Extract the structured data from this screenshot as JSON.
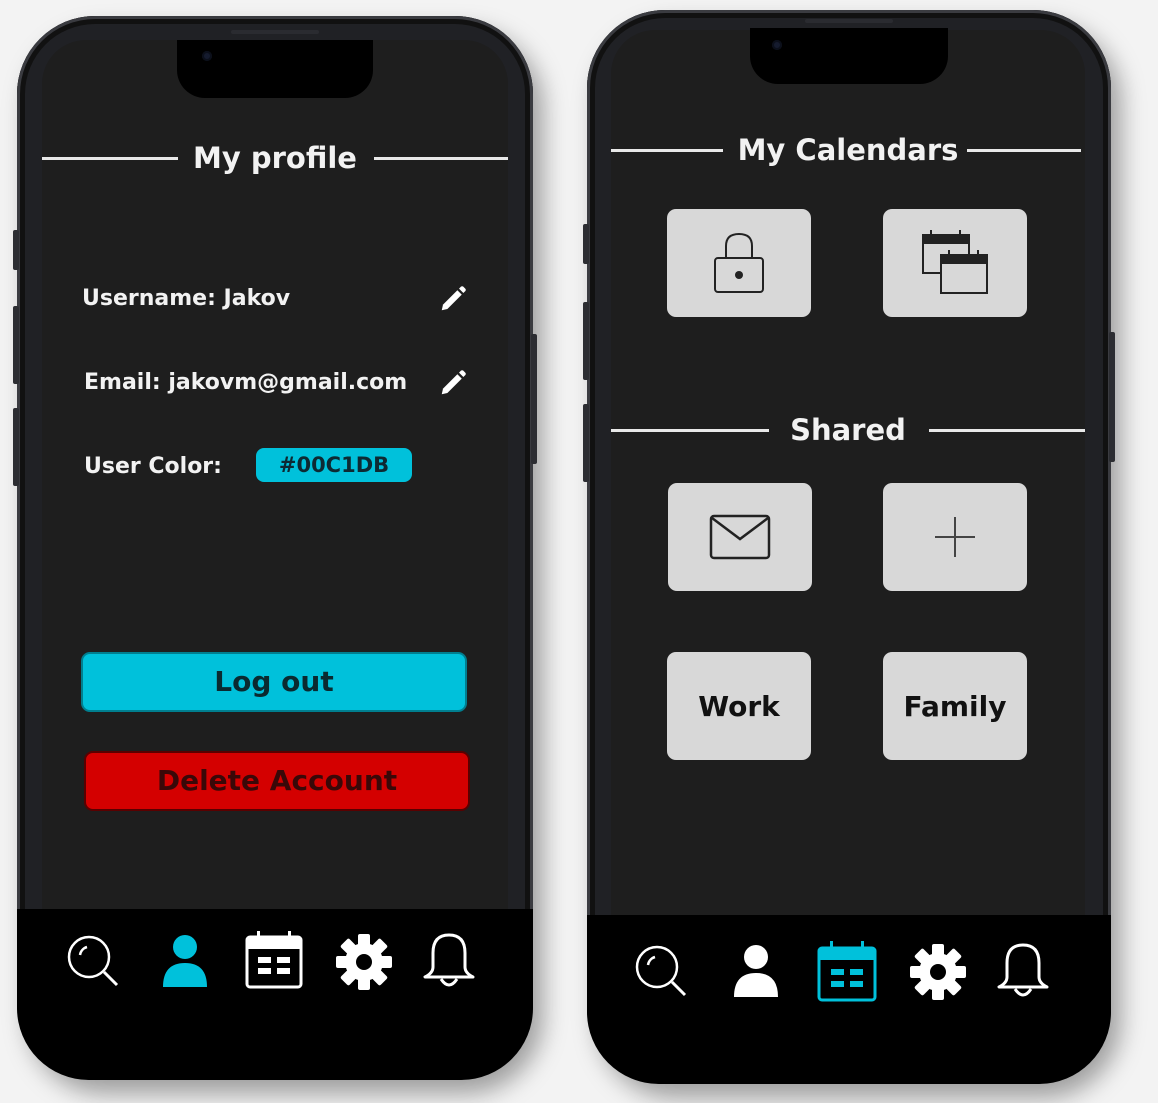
{
  "colors": {
    "accent": "#00C1DB",
    "danger": "#D40000",
    "screen_bg": "#1E1E1E",
    "nav_bg": "#000000",
    "tile_bg": "#D8D8D8"
  },
  "profile_screen": {
    "title": "My profile",
    "username_label": "Username: Jakov",
    "email_label": "Email: jakovm@gmail.com",
    "user_color_label": "User Color:",
    "user_color_value": "#00C1DB",
    "logout_label": "Log out",
    "delete_label": "Delete Account",
    "edit_icon": "pencil-icon",
    "active_tab": "profile"
  },
  "calendars_screen": {
    "title": "My Calendars",
    "my_tiles": [
      {
        "icon": "lock-icon"
      },
      {
        "icon": "calendars-icon"
      }
    ],
    "shared_title": "Shared",
    "shared_tiles": [
      {
        "icon": "mail-icon"
      },
      {
        "icon": "plus-icon"
      },
      {
        "label": "Work"
      },
      {
        "label": "Family"
      }
    ],
    "active_tab": "calendar"
  },
  "nav_items": [
    {
      "icon": "search-icon"
    },
    {
      "icon": "user-icon"
    },
    {
      "icon": "calendar-icon"
    },
    {
      "icon": "gear-icon"
    },
    {
      "icon": "bell-icon"
    }
  ]
}
